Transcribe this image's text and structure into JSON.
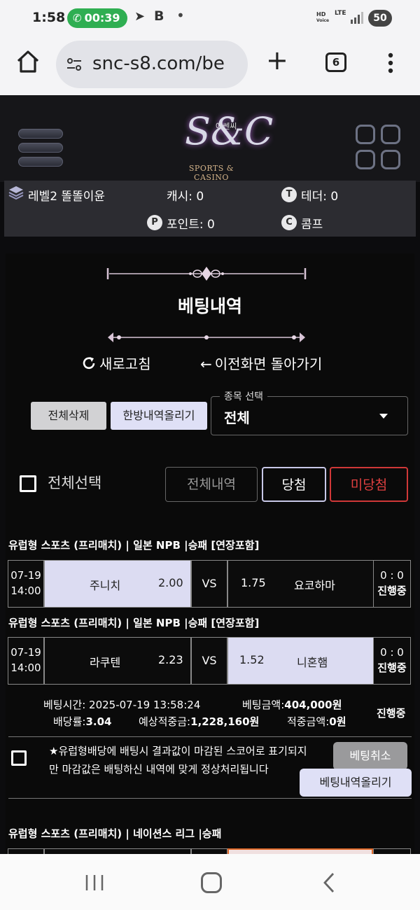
{
  "status_bar": {
    "time": "1:58",
    "call_timer": "00:39",
    "hd_label": "HD",
    "voice_label": "Voice",
    "network": "LTE",
    "battery": "50"
  },
  "browser": {
    "url": "snc-s8.com/be",
    "tab_count": "6"
  },
  "site": {
    "logo_text": "S&C",
    "logo_korean": "에쎈씨",
    "logo_tagline": "SPORTS & CASINO"
  },
  "user": {
    "level": "레벨2 똘똘이윤",
    "cash": "캐시: 0",
    "tether": "테더: 0",
    "points": "포인트: 0",
    "comp": "콤프",
    "tether_icon": "T",
    "points_icon": "P",
    "comp_icon": "C"
  },
  "page": {
    "title": "베팅내역",
    "refresh": "새로고침",
    "back": "이전화면 돌아가기"
  },
  "controls": {
    "delete_all": "전체삭제",
    "upload_batch": "한방내역올리기",
    "sport_select_legend": "종목 선택",
    "sport_select_value": "전체",
    "select_all": "전체선택",
    "filter_all": "전체내역",
    "filter_win": "당첨",
    "filter_lose": "미당첨"
  },
  "bets": [
    {
      "header": "유럽형 스포츠 (프리매치) | 일본 NPB  |승패 [연장포함]",
      "date": "07-19",
      "time": "14:00",
      "home_team": "주니치",
      "home_odds": "2.00",
      "vs": "VS",
      "away_odds": "1.75",
      "away_team": "요코하마",
      "score": "0 : 0",
      "status": "진행중",
      "selected": "home"
    },
    {
      "header": "유럽형 스포츠 (프리매치) | 일본 NPB  |승패 [연장포함]",
      "date": "07-19",
      "time": "14:00",
      "home_team": "라쿠텐",
      "home_odds": "2.23",
      "vs": "VS",
      "away_odds": "1.52",
      "away_team": "니혼햄",
      "score": "0 : 0",
      "status": "진행중",
      "selected": "away"
    }
  ],
  "summary": {
    "bet_time_label": "베팅시간:",
    "bet_time": "2025-07-19 13:58:24",
    "bet_amount_label": "베팅금액:",
    "bet_amount": "404,000원",
    "odds_label": "배당률:",
    "odds": "3.04",
    "expected_label": "예상적중금:",
    "expected": "1,228,160원",
    "won_label": "적중금액:",
    "won": "0원",
    "status": "진행중"
  },
  "notice": {
    "text": "★유럽형배당에 배팅시 결과값이 마감된 스코어로 표기되지만 마감값은 배팅하신 내역에 맞게 정상처리됩니다",
    "cancel": "베팅취소",
    "upload": "베팅내역올리기"
  },
  "next_bet": {
    "header": "유럽형 스포츠 (프리매치) | 네이션스 리그  |승패"
  }
}
